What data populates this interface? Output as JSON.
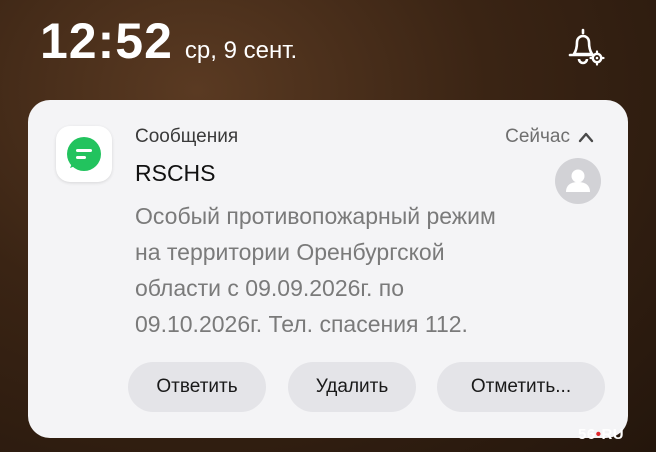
{
  "status_bar": {
    "time": "12:52",
    "date": "ср, 9 сент."
  },
  "notification": {
    "app_name": "Сообщения",
    "time_label": "Сейчас",
    "sender": "RSCHS",
    "message_lines": [
      "Особый противопожарный режим",
      "на территории Оренбургской",
      "области с 09.09.2026г. по",
      "09.10.2026г. Тел. спасения 112."
    ],
    "actions": {
      "reply": "Ответить",
      "delete": "Удалить",
      "mark": "Отметить..."
    },
    "app_icon": "messages-bubble-icon",
    "accent_color": "#22c35e"
  },
  "watermark": {
    "left": "56",
    "dot": "•",
    "right": "RU"
  }
}
